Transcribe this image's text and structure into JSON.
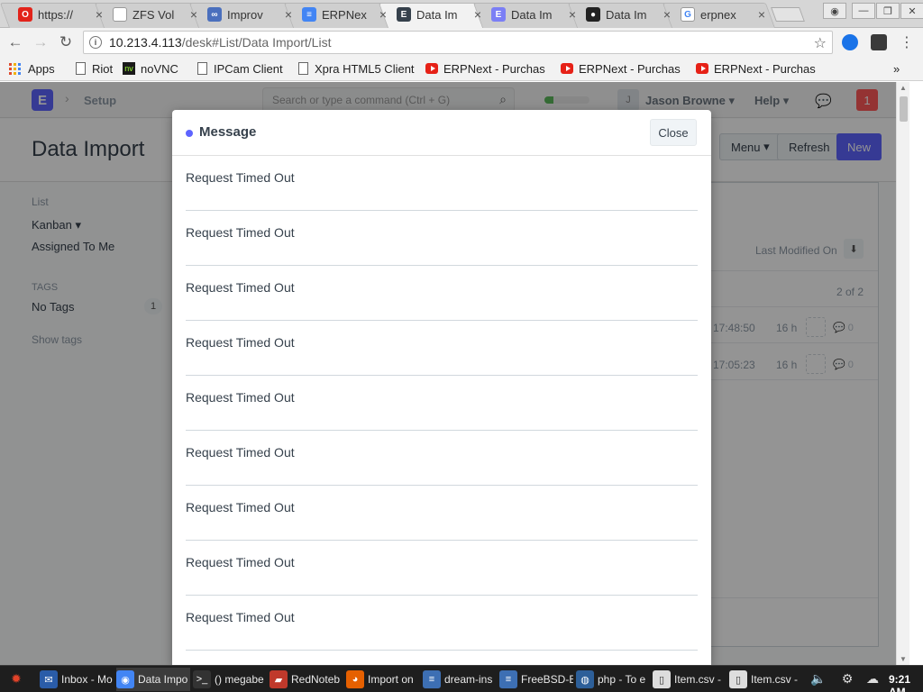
{
  "browser": {
    "tabs": [
      {
        "title": "https://",
        "icon": "oracle-icon",
        "color": "#e2231a",
        "glyph": "O"
      },
      {
        "title": "ZFS Vol",
        "icon": "doc-icon",
        "color": "#ffffff",
        "glyph": ""
      },
      {
        "title": "Improv",
        "icon": "link-icon",
        "color": "#4a6fbd",
        "glyph": "∞"
      },
      {
        "title": "ERPNex",
        "icon": "gdocs-icon",
        "color": "#4285f4",
        "glyph": "≡"
      },
      {
        "title": "Data Im",
        "icon": "erpnext-dark-icon",
        "color": "#36414c",
        "glyph": "E"
      },
      {
        "title": "Data Im",
        "icon": "erpnext-icon",
        "color": "#7b7ff5",
        "glyph": "E"
      },
      {
        "title": "Data Im",
        "icon": "github-icon",
        "color": "#222222",
        "glyph": "●"
      },
      {
        "title": "erpnex",
        "icon": "google-icon",
        "color": "#ffffff",
        "glyph": "G"
      }
    ],
    "active_tab": 4,
    "tab_close": "×",
    "url_host": "10.213.4.113",
    "url_path": "/desk#List/Data Import/List",
    "bookmarks": [
      {
        "label": "Apps"
      },
      {
        "label": "Riot"
      },
      {
        "label": "noVNC"
      },
      {
        "label": "IPCam Client"
      },
      {
        "label": "Xpra HTML5 Client"
      },
      {
        "label": "ERPNext - Purchas"
      },
      {
        "label": "ERPNext - Purchas"
      },
      {
        "label": "ERPNext - Purchas"
      }
    ],
    "bookmarks_more": "»"
  },
  "app": {
    "logo_letter": "E",
    "breadcrumb": "Setup",
    "search_placeholder": "Search or type a command (Ctrl + G)",
    "sync_progress": 0.2,
    "user_initial": "J",
    "user_name": "Jason Browne",
    "help_label": "Help",
    "notification_count": "1",
    "page_title": "Data Import",
    "menu_label": "Menu",
    "refresh_label": "Refresh",
    "new_label": "New",
    "sidebar": {
      "list_heading": "List",
      "kanban": "Kanban",
      "assigned_to_me": "Assigned To Me",
      "tags_heading": "TAGS",
      "no_tags": "No Tags",
      "no_tags_count": "1",
      "show_tags": "Show tags"
    },
    "list": {
      "sort_label": "Last Modified On",
      "count_label": "2 of 2",
      "rows": [
        {
          "time": "17:48:50",
          "age": "16 h",
          "comments": "0"
        },
        {
          "time": "17:05:23",
          "age": "16 h",
          "comments": "0"
        }
      ]
    }
  },
  "modal": {
    "title": "Message",
    "close_label": "Close",
    "indicator_color": "#5e64ff",
    "messages": [
      "Request Timed Out",
      "Request Timed Out",
      "Request Timed Out",
      "Request Timed Out",
      "Request Timed Out",
      "Request Timed Out",
      "Request Timed Out",
      "Request Timed Out",
      "Request Timed Out"
    ]
  },
  "taskbar": {
    "items": [
      {
        "label": "Inbox - Mo",
        "icon": "thunderbird-icon"
      },
      {
        "label": "Data Impo",
        "icon": "chrome-icon"
      },
      {
        "label": "() megabe",
        "icon": "terminal-icon"
      },
      {
        "label": "RedNoteb",
        "icon": "rednotebook-icon"
      },
      {
        "label": "Import on",
        "icon": "firefox-icon"
      },
      {
        "label": "dream-ins",
        "icon": "document-icon"
      },
      {
        "label": "FreeBSD-E",
        "icon": "document-icon"
      },
      {
        "label": "php - To e",
        "icon": "globe-icon"
      },
      {
        "label": "Item.csv -",
        "icon": "file-icon"
      },
      {
        "label": "Item.csv -",
        "icon": "file-icon"
      }
    ],
    "clock": "9:21 AM"
  }
}
